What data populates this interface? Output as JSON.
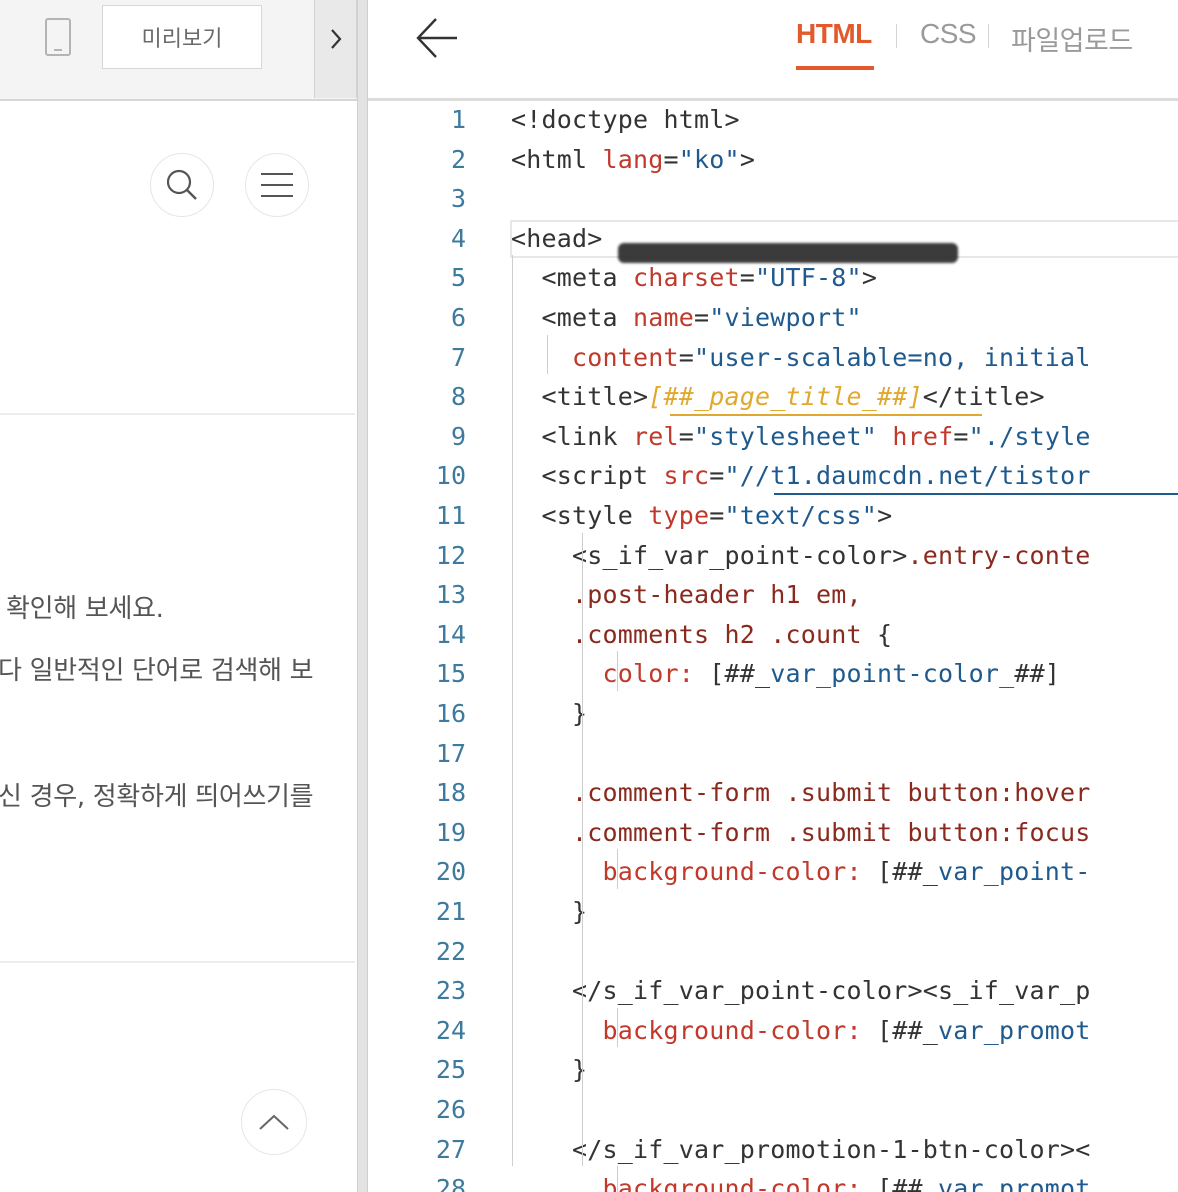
{
  "preview": {
    "device_icon": "mobile-device-icon",
    "preview_button_label": "미리보기",
    "collapse_icon": "chevron-right-icon",
    "search_icon": "search-icon",
    "menu_icon": "hamburger-menu-icon",
    "scroll_top_icon": "chevron-up-icon",
    "hints": [
      "확인해 보세요.",
      "다 일반적인 단어로 검색해 보",
      "신 경우, 정확하게 띄어쓰기를"
    ]
  },
  "editor": {
    "back_icon": "arrow-left-icon",
    "tabs": [
      {
        "label": "HTML",
        "active": true
      },
      {
        "label": "CSS",
        "active": false
      },
      {
        "label": "파일업로드",
        "active": false
      }
    ],
    "accent_color": "#e25a2c",
    "line_numbers": [
      "1",
      "2",
      "3",
      "4",
      "5",
      "6",
      "7",
      "8",
      "9",
      "10",
      "11",
      "12",
      "13",
      "14",
      "15",
      "16",
      "17",
      "18",
      "19",
      "20",
      "21",
      "22",
      "23",
      "24",
      "25",
      "26",
      "27",
      "28"
    ],
    "lines": [
      [
        {
          "t": "<!doctype html>",
          "c": "tag"
        }
      ],
      [
        {
          "t": "<html ",
          "c": "tag"
        },
        {
          "t": "lang",
          "c": "attr"
        },
        {
          "t": "=",
          "c": "tag"
        },
        {
          "t": "\"ko\"",
          "c": "str"
        },
        {
          "t": ">",
          "c": "tag"
        }
      ],
      [],
      [
        {
          "t": "<head>",
          "c": "tag"
        }
      ],
      [
        {
          "t": "  <meta ",
          "c": "tag"
        },
        {
          "t": "charset",
          "c": "attr"
        },
        {
          "t": "=",
          "c": "tag"
        },
        {
          "t": "\"UTF-8\"",
          "c": "str"
        },
        {
          "t": ">",
          "c": "tag"
        }
      ],
      [
        {
          "t": "  <meta ",
          "c": "tag"
        },
        {
          "t": "name",
          "c": "attr"
        },
        {
          "t": "=",
          "c": "tag"
        },
        {
          "t": "\"viewport\"",
          "c": "str"
        }
      ],
      [
        {
          "t": "    content",
          "c": "attr"
        },
        {
          "t": "=",
          "c": "tag"
        },
        {
          "t": "\"user-scalable=no, initial",
          "c": "str"
        }
      ],
      [
        {
          "t": "  <title>",
          "c": "tag"
        },
        {
          "t": "[##_page_title_##]",
          "c": "tpl"
        },
        {
          "t": "</title>",
          "c": "tag"
        }
      ],
      [
        {
          "t": "  <link ",
          "c": "tag"
        },
        {
          "t": "rel",
          "c": "attr"
        },
        {
          "t": "=",
          "c": "tag"
        },
        {
          "t": "\"stylesheet\" ",
          "c": "str"
        },
        {
          "t": "href",
          "c": "attr"
        },
        {
          "t": "=",
          "c": "tag"
        },
        {
          "t": "\"./style",
          "c": "str"
        }
      ],
      [
        {
          "t": "  <script ",
          "c": "tag"
        },
        {
          "t": "src",
          "c": "attr"
        },
        {
          "t": "=",
          "c": "tag"
        },
        {
          "t": "\"//t1.daumcdn.net/tistor",
          "c": "str"
        }
      ],
      [
        {
          "t": "  <style ",
          "c": "tag"
        },
        {
          "t": "type",
          "c": "attr"
        },
        {
          "t": "=",
          "c": "tag"
        },
        {
          "t": "\"text/css\"",
          "c": "str"
        },
        {
          "t": ">",
          "c": "tag"
        }
      ],
      [
        {
          "t": "    <s_if_var_point-color>",
          "c": "tag"
        },
        {
          "t": ".entry-conte",
          "c": "sel"
        }
      ],
      [
        {
          "t": "    .post-header h1 em,",
          "c": "sel"
        }
      ],
      [
        {
          "t": "    .comments h2 .count ",
          "c": "sel"
        },
        {
          "t": "{",
          "c": "tag"
        }
      ],
      [
        {
          "t": "      color: ",
          "c": "prop"
        },
        {
          "t": "[##_",
          "c": "tag"
        },
        {
          "t": "var_point-color_",
          "c": "var"
        },
        {
          "t": "##]",
          "c": "tag"
        }
      ],
      [
        {
          "t": "    }",
          "c": "tag"
        }
      ],
      [],
      [
        {
          "t": "    .comment-form .submit button:hover",
          "c": "sel"
        }
      ],
      [
        {
          "t": "    .comment-form .submit button:focus",
          "c": "sel"
        }
      ],
      [
        {
          "t": "      background-color: ",
          "c": "prop"
        },
        {
          "t": "[##_",
          "c": "tag"
        },
        {
          "t": "var_point-",
          "c": "var"
        }
      ],
      [
        {
          "t": "    }",
          "c": "tag"
        }
      ],
      [],
      [
        {
          "t": "    </s_if_var_point-color><s_if_var_p",
          "c": "tag"
        }
      ],
      [
        {
          "t": "      background-color: ",
          "c": "prop"
        },
        {
          "t": "[##_",
          "c": "tag"
        },
        {
          "t": "var_promot",
          "c": "var"
        }
      ],
      [
        {
          "t": "    }",
          "c": "tag"
        }
      ],
      [],
      [
        {
          "t": "    </s_if_var_promotion-1-btn-color><",
          "c": "tag"
        }
      ],
      [
        {
          "t": "      background-color: ",
          "c": "prop"
        },
        {
          "t": "[##_",
          "c": "tag"
        },
        {
          "t": "var_promot",
          "c": "var"
        }
      ]
    ]
  }
}
